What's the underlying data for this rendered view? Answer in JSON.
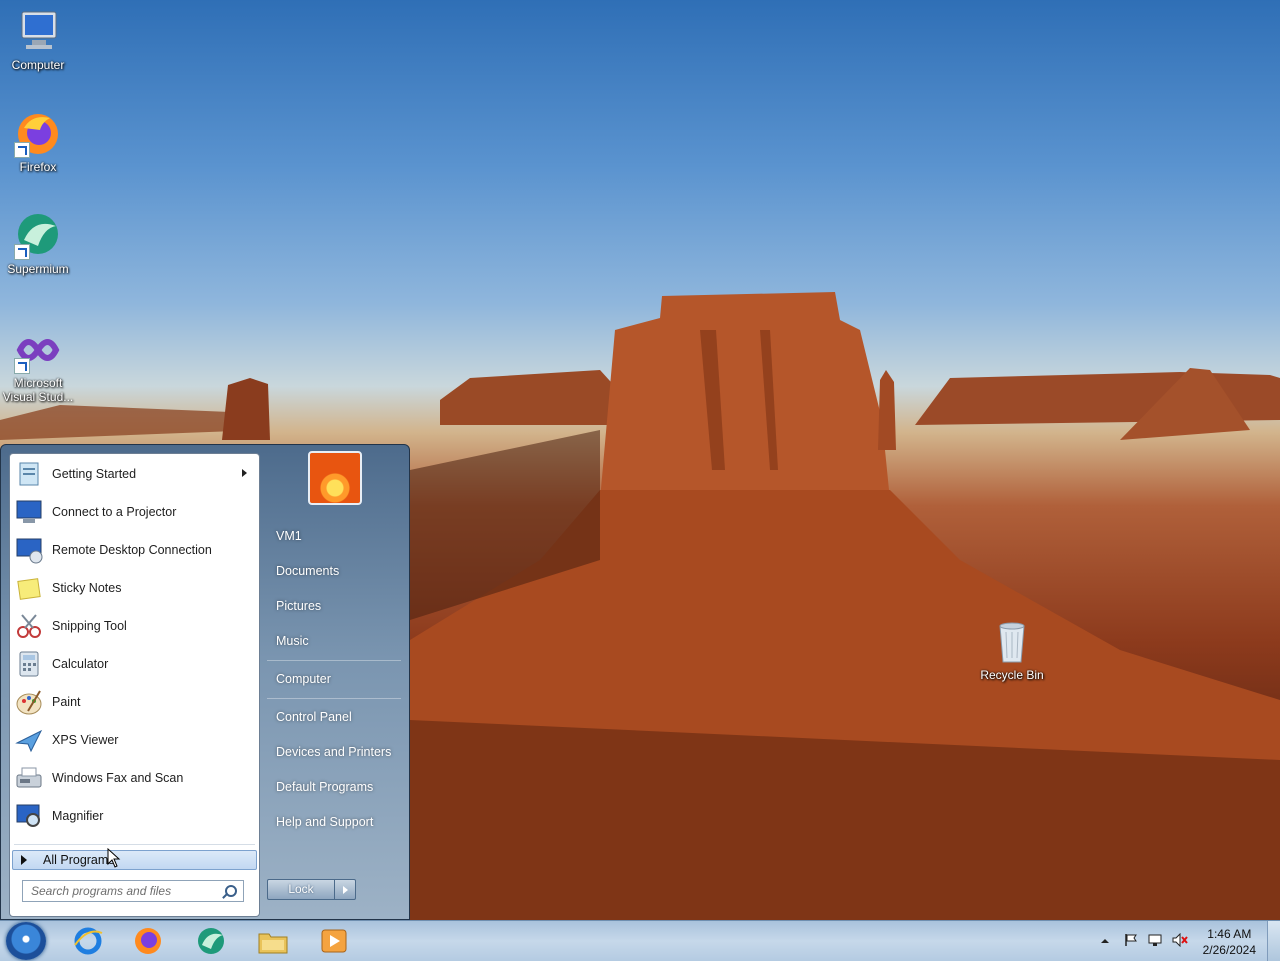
{
  "desktop": {
    "icons": [
      {
        "label": "Computer"
      },
      {
        "label": "Firefox"
      },
      {
        "label": "Supermium"
      },
      {
        "label": "Microsoft Visual Stud..."
      },
      {
        "label": "Recycle Bin"
      }
    ]
  },
  "start_menu": {
    "programs": [
      {
        "label": "Getting Started",
        "has_submenu": true
      },
      {
        "label": "Connect to a Projector"
      },
      {
        "label": "Remote Desktop Connection"
      },
      {
        "label": "Sticky Notes"
      },
      {
        "label": "Snipping Tool"
      },
      {
        "label": "Calculator"
      },
      {
        "label": "Paint"
      },
      {
        "label": "XPS Viewer"
      },
      {
        "label": "Windows Fax and Scan"
      },
      {
        "label": "Magnifier"
      }
    ],
    "all_programs_label": "All Programs",
    "search_placeholder": "Search programs and files",
    "right_links": [
      {
        "label": "VM1"
      },
      {
        "label": "Documents"
      },
      {
        "label": "Pictures"
      },
      {
        "label": "Music"
      },
      {
        "label": "Computer"
      },
      {
        "label": "Control Panel"
      },
      {
        "label": "Devices and Printers"
      },
      {
        "label": "Default Programs"
      },
      {
        "label": "Help and Support"
      }
    ],
    "lock_label": "Lock"
  },
  "taskbar": {
    "pinned": [
      "internet-explorer",
      "firefox",
      "supermium",
      "windows-explorer",
      "media-player"
    ],
    "clock_time": "1:46 AM",
    "clock_date": "2/26/2024"
  },
  "colors": {
    "taskbar": "#b4cbe2",
    "start_menu": "#7a95b0",
    "highlight": "#c2d8f2"
  }
}
